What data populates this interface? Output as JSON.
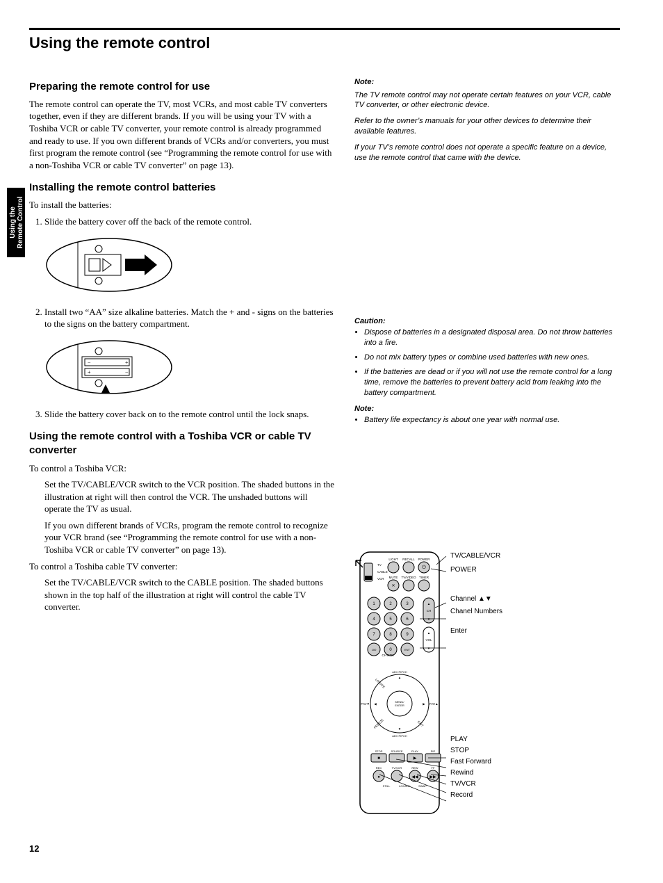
{
  "tab": {
    "line1": "Using the",
    "line2": "Remote Control"
  },
  "title": "Using the remote control",
  "h_prepare": "Preparing the remote control for use",
  "p_prepare": "The remote control can operate the TV, most VCRs, and most cable TV converters together, even if they are different brands. If you will be using your TV with a Toshiba VCR or cable TV converter, your remote control is already programmed and ready to use. If you own different brands of VCRs and/or converters, you must first program the remote control (see “Programming the remote control for use with a non-Toshiba VCR or cable TV converter” on page 13).",
  "h_install": "Installing the remote control batteries",
  "p_install_lead": "To install the batteries:",
  "step1": "Slide the battery cover off the back of the remote control.",
  "step2": "Install two “AA” size alkaline batteries. Match the + and - signs on the batteries to the signs on the battery compartment.",
  "step3": "Slide the battery cover back on to the remote control until the lock snaps.",
  "h_toshiba": "Using the remote control with a Toshiba VCR or cable TV converter",
  "p_vcr_lead": "To control a Toshiba VCR:",
  "p_vcr_1": "Set the TV/CABLE/VCR switch to the VCR position. The shaded buttons in the illustration at right will then control the VCR. The unshaded buttons will operate the TV as usual.",
  "p_vcr_2": "If you own different brands of VCRs, program the remote control to recognize your VCR brand (see “Programming the remote control for use with a non-Toshiba VCR or cable TV converter” on page 13).",
  "p_cable_lead": "To control a Toshiba cable TV converter:",
  "p_cable_1": "Set the TV/CABLE/VCR switch to the CABLE position. The shaded buttons shown in the top half of the illustration at right will control the cable TV converter.",
  "note1_label": "Note:",
  "note1_a": "The TV remote control may not operate certain features on your VCR, cable TV converter, or other electronic device.",
  "note1_b": "Refer to the owner’s manuals for your other devices to determine their available features.",
  "note1_c": "If your TV’s remote control does not operate a specific feature on a device, use the remote control that came with the device.",
  "caution_label": "Caution:",
  "caution_a": "Dispose of batteries in a designated disposal area. Do not throw batteries into a fire.",
  "caution_b": "Do not mix battery types or combine used batteries with new ones.",
  "caution_c": "If the batteries are dead or if you will not use the remote control for a long time, remove the batteries to prevent battery acid from leaking into the battery compartment.",
  "note2_label": "Note:",
  "note2_a": "Battery life expectancy is about one year with normal use.",
  "callouts": {
    "c1": "TV/CABLE/VCR",
    "c2": "POWER",
    "c3": "Channel ▲▼",
    "c4": "Chanel Numbers",
    "c5": "Enter",
    "c6": "PLAY",
    "c7": "STOP",
    "c8": "Fast Forward",
    "c9": "Rewind",
    "c10": "TV/VCR",
    "c11": "Record"
  },
  "remote_labels": {
    "switch": {
      "tv": "TV",
      "cable": "CABLE",
      "vcr": "VCR"
    },
    "row1": [
      "LIGHT",
      "RECALL",
      "POWER"
    ],
    "row2": [
      "MUTE",
      "TV/VIDEO",
      "TIMER"
    ],
    "digits": [
      "1",
      "2",
      "3",
      "4",
      "5",
      "6",
      "7",
      "8",
      "9",
      "100",
      "0",
      "ENT"
    ],
    "ch": "CH",
    "vol": "VOL",
    "chrtn": "CH RTN",
    "menu": "MENU / ENTER",
    "adv_pip": "ADV\nPIPCH",
    "fav_l": "FAV▼",
    "fav_r": "FAV▲",
    "exit": "EXIT",
    "locate": "LOCATE",
    "freeze": "FREEZE",
    "trans": [
      "STOP",
      "SOURCE",
      "PLAY",
      "PIP"
    ],
    "trans2": [
      "REC",
      "TV/VCR",
      "REW",
      "FF"
    ],
    "trans3": [
      "STILL",
      "LOCATE",
      "SWAP"
    ]
  },
  "pagenum": "12"
}
